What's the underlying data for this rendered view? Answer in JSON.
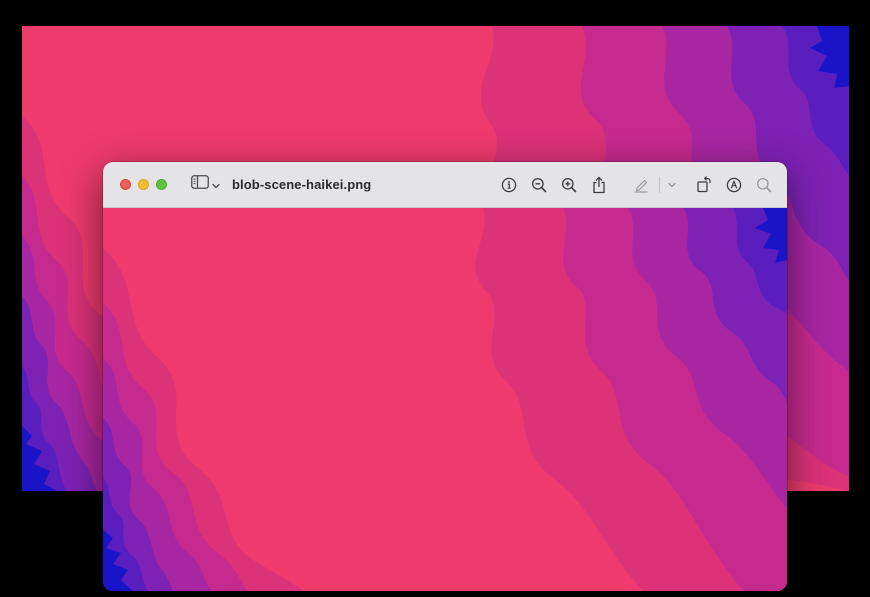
{
  "window": {
    "title": "blob-scene-haikei.png",
    "traffic_lights": [
      "close",
      "minimize",
      "zoom"
    ]
  },
  "toolbar": {
    "left": [
      {
        "name": "sidebar-toggle",
        "icon": "sidebar-icon",
        "has_dropdown": true
      }
    ],
    "right": [
      {
        "name": "info-button",
        "icon": "info-icon"
      },
      {
        "name": "zoom-out-button",
        "icon": "zoom-out-icon"
      },
      {
        "name": "zoom-in-button",
        "icon": "zoom-in-icon"
      },
      {
        "name": "share-button",
        "icon": "share-icon"
      },
      {
        "name": "highlight-button",
        "icon": "highlighter-icon"
      },
      {
        "name": "highlight-menu-button",
        "icon": "chevron-down-icon"
      },
      {
        "name": "rotate-button",
        "icon": "rotate-icon"
      },
      {
        "name": "markup-button",
        "icon": "markup-pen-icon"
      },
      {
        "name": "search-button",
        "icon": "search-icon"
      }
    ]
  },
  "colors": {
    "background": "#000000",
    "wave_pink": "#ee3a6d",
    "wave_magenta": "#c72a8f",
    "wave_purple": "#8a22b2",
    "wave_violet": "#5a1ebf",
    "wave_blue": "#1a14c8",
    "titlebar": "#e4e3e6"
  }
}
